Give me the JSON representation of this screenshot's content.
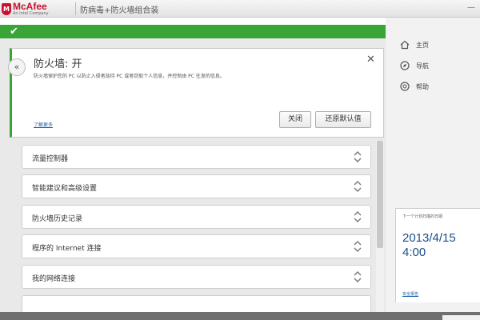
{
  "window": {
    "brand_name": "McAfee",
    "brand_sub": "An Intel Company",
    "title": "防病毒+防火墙组合装",
    "controls_glyph": "—"
  },
  "status": {
    "icon": "check-icon",
    "color": "#3aa537"
  },
  "firewall_panel": {
    "back_glyph": "«",
    "title": "防火墙: 开",
    "close_glyph": "✕",
    "description": "防火墙保护您的 PC 以防止入侵者劫持 PC 或者窃取个人信息，并控制由 PC 往发的信息。",
    "learn_more": "了解更多",
    "buttons": {
      "close": "关闭",
      "reset": "还原默认值"
    }
  },
  "list_items": [
    {
      "label": "流量控制器"
    },
    {
      "label": "智能建议和高级设置"
    },
    {
      "label": "防火墙历史记录"
    },
    {
      "label": "程序的 Internet 连接"
    },
    {
      "label": "我的网络连接"
    }
  ],
  "sidebar": {
    "nav": [
      {
        "label": "主页",
        "icon": "home-icon"
      },
      {
        "label": "导航",
        "icon": "compass-icon"
      },
      {
        "label": "帮助",
        "icon": "help-icon"
      }
    ],
    "schedule": {
      "label": "下一个计划扫描的日期",
      "date": "2013/4/15",
      "time": "4:00",
      "link": "安全报告"
    }
  },
  "colors": {
    "accent_green": "#3aa537",
    "brand_red": "#c8102e",
    "link_blue": "#1a5ea8"
  }
}
